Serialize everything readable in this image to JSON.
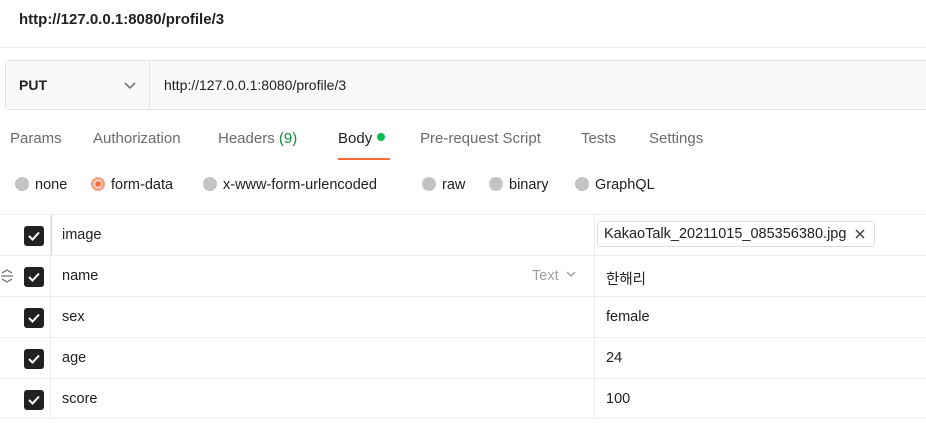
{
  "window": {
    "title": "http://127.0.0.1:8080/profile/3"
  },
  "request": {
    "method": "PUT",
    "url": "http://127.0.0.1:8080/profile/3"
  },
  "tabs": {
    "params": "Params",
    "authorization": "Authorization",
    "headers": "Headers",
    "headers_count": "(9)",
    "body": "Body",
    "prerequest": "Pre-request Script",
    "tests": "Tests",
    "settings": "Settings"
  },
  "body_types": {
    "none": "none",
    "form_data": "form-data",
    "urlencoded": "x-www-form-urlencoded",
    "raw": "raw",
    "binary": "binary",
    "graphql": "GraphQL",
    "selected": "form-data"
  },
  "form_rows": [
    {
      "key": "image",
      "value": "KakaoTalk_20211015_085356380.jpg",
      "checked": true
    },
    {
      "key": "name",
      "type": "Text",
      "value": "한해리",
      "checked": true
    },
    {
      "key": "sex",
      "value": "female",
      "checked": true
    },
    {
      "key": "age",
      "value": "24",
      "checked": true
    },
    {
      "key": "score",
      "value": "100",
      "checked": true
    }
  ],
  "colors": {
    "accent": "#ff6c37",
    "status_dot": "#0cbb52",
    "headers_count": "#0f8a3c"
  }
}
